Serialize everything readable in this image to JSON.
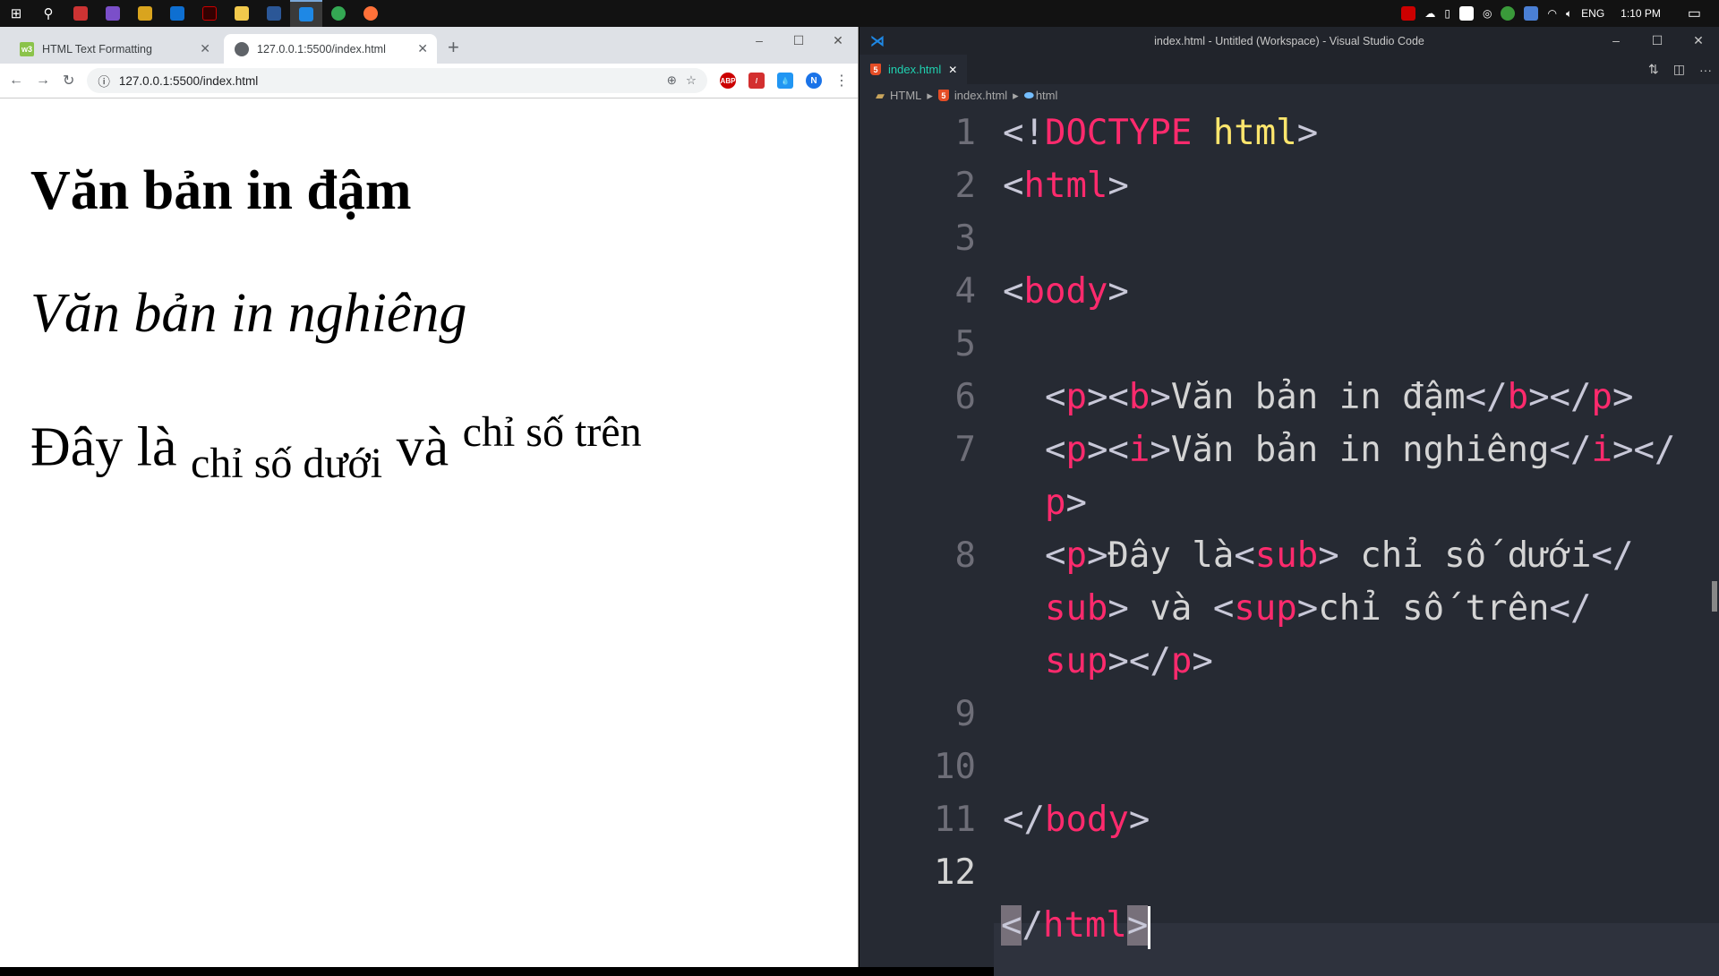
{
  "taskbar": {
    "apps": [
      "windows-start",
      "search",
      "unikey",
      "visual-studio",
      "app-4",
      "teamviewer",
      "garena",
      "file-explorer",
      "word",
      "vscode",
      "chrome",
      "firefox"
    ],
    "tray": {
      "language": "ENG",
      "time": "1:10 PM"
    }
  },
  "browser": {
    "tabs": [
      {
        "title": "HTML Text Formatting",
        "favicon": "w3schools"
      },
      {
        "title": "127.0.0.1:5500/index.html",
        "favicon": "globe"
      }
    ],
    "new_tab": "+",
    "address": "127.0.0.1:5500/index.html",
    "extensions": [
      "ABP",
      "pdf",
      "dropbox"
    ],
    "profile": "N",
    "page": {
      "bold": "Văn bản in đậm",
      "italic": "Văn bản in nghiêng",
      "p3_start": "Đây là",
      "sub": "chỉ số dưới",
      "p3_mid": "và",
      "sup": "chỉ số trên"
    }
  },
  "vscode": {
    "title": "index.html - Untitled (Workspace) - Visual Studio Code",
    "tab": "index.html",
    "breadcrumb": [
      "HTML",
      "index.html",
      "html"
    ],
    "line_numbers": [
      "1",
      "2",
      "3",
      "4",
      "5",
      "6",
      "7",
      "",
      "8",
      "",
      "",
      "9",
      "10",
      "11",
      "12"
    ],
    "code": {
      "l1a": "<!",
      "l1b": "DOCTYPE",
      "l1c": " html",
      "l1d": ">",
      "l2": "html",
      "l4": "body",
      "l6": "Văn bản in đậm",
      "l7": "Văn bản in nghiêng",
      "l8a": "Đây là",
      "l8b": " chỉ số dưới",
      "l8c": " và ",
      "l8d": "chỉ số trên",
      "l10": "body",
      "l12": "html"
    },
    "colors": {
      "tag": "#ff2a6d",
      "keyword": "#ffe66d",
      "bg": "#262a33"
    }
  }
}
